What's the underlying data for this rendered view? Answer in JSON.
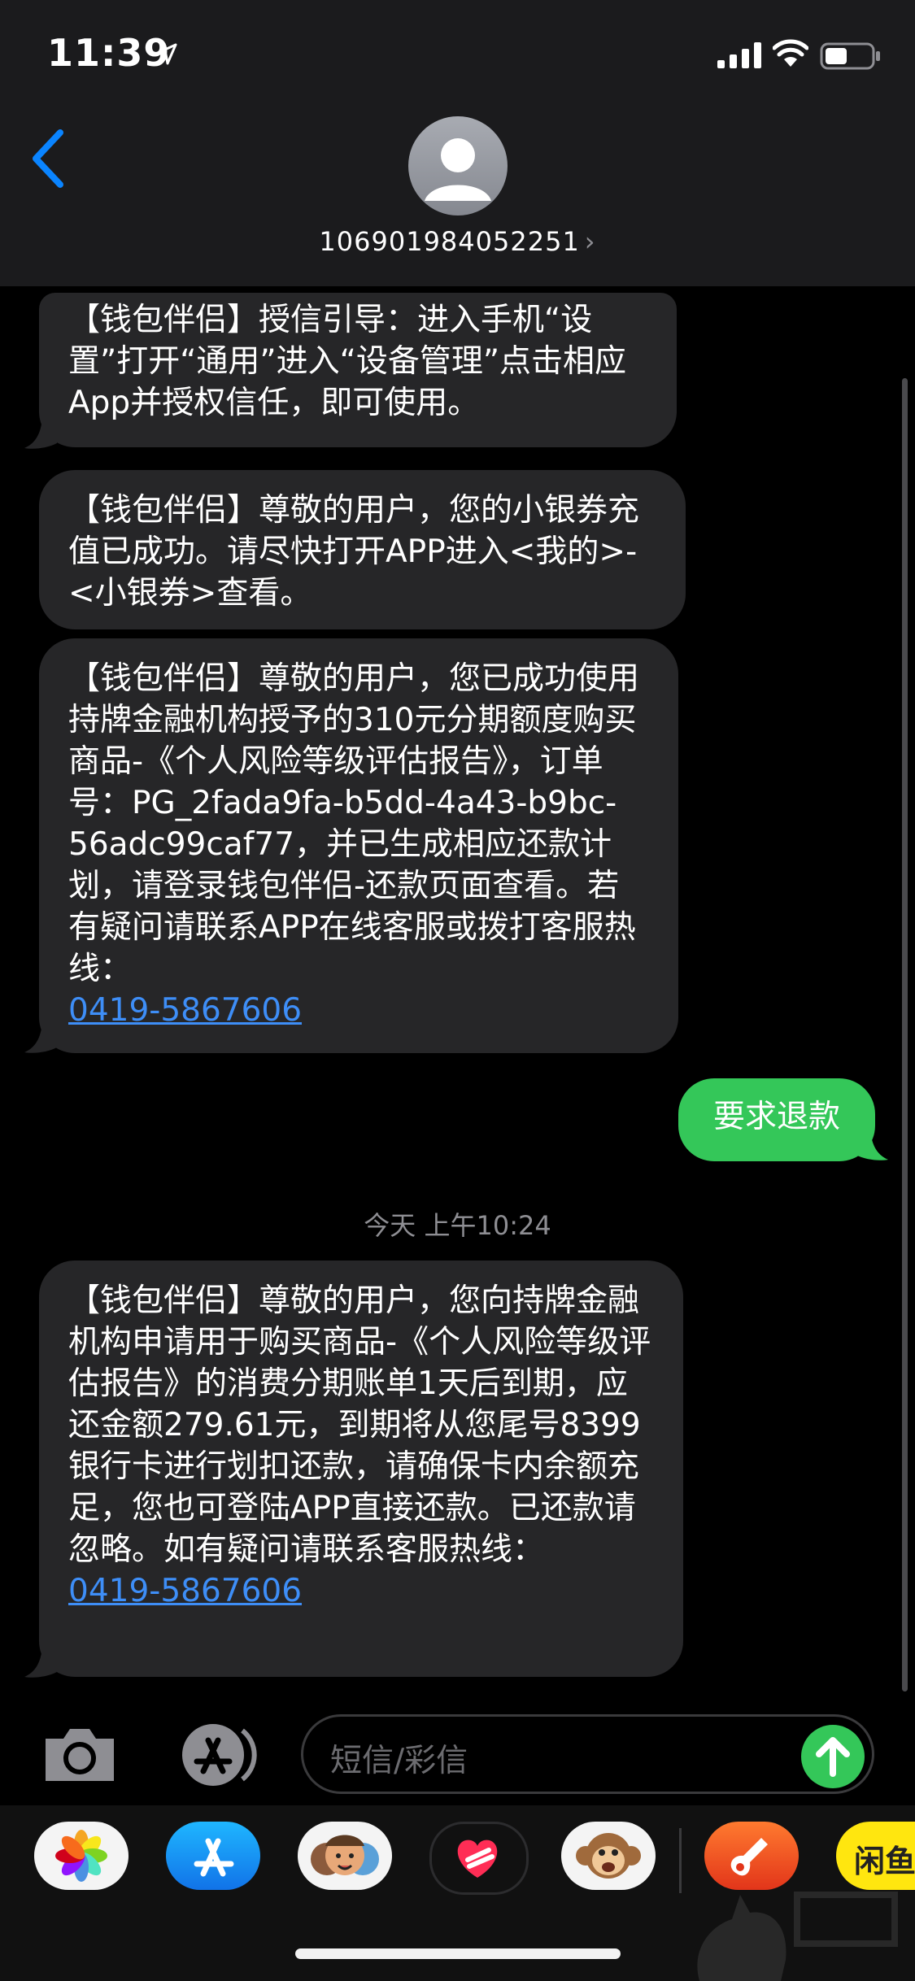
{
  "status_bar": {
    "time": "11:39"
  },
  "header": {
    "contact": "106901984052251",
    "chevron": "›"
  },
  "messages": {
    "m1": "【钱包伴侣】授信引导：进入手机“设置”打开“通用”进入“设备管理”点击相应App并授权信任，即可使用。",
    "m2": "【钱包伴侣】尊敬的用户，您的小银券充值已成功。请尽快打开APP进入<我的>-<小银券>查看。",
    "m3_text": "【钱包伴侣】尊敬的用户，您已成功使用持牌金融机构授予的310元分期额度购买商品-《个人风险等级评估报告》，订单号：PG_2fada9fa-b5dd-4a43-b9bc-56adc99caf77，并已生成相应还款计划，请登录钱包伴侣-还款页面查看。若有疑问请联系APP在线客服或拨打客服热线：",
    "m3_link": "0419-5867606",
    "sent": "要求退款",
    "timestamp_day": "今天",
    "timestamp_time": "上午10:24",
    "m4_text": "【钱包伴侣】尊敬的用户，您向持牌金融机构申请用于购买商品-《个人风险等级评估报告》的消费分期账单1天后到期，应还金额279.61元，到期将从您尾号8399银行卡进行划扣还款，请确保卡内余额充足，您也可登陆APP直接还款。已还款请忽略。如有疑问请联系客服热线：",
    "m4_link": "0419-5867606"
  },
  "composer": {
    "placeholder": "短信/彩信"
  },
  "drawer": {
    "apps": [
      "photos-app",
      "app-store-app",
      "memoji-app",
      "digital-touch-app",
      "animoji-app",
      "garageband-app",
      "xianyu-app"
    ],
    "partial_label": "闲鱼"
  },
  "colors": {
    "accent": "#0a84ff",
    "sent_bubble": "#34c759",
    "received_bubble": "#262628",
    "link": "#3e8ef7"
  }
}
